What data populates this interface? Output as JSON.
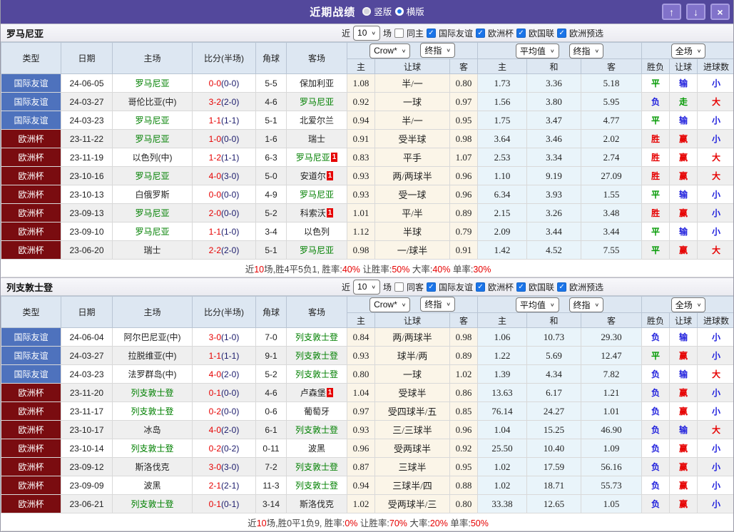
{
  "palette": {
    "titlebar_purple": "#53489c",
    "type_blue": "#4e72bd",
    "type_maroon": "#7a0c10",
    "win_red": "#e60000",
    "draw_green": "#009900",
    "loss_blue": "#2020dd",
    "team_green": "#008000",
    "handicap_bg": "#fbf5e8",
    "avg_bg": "#e9f4fa"
  },
  "titlebar": {
    "title": "近期战绩",
    "radios": [
      {
        "label": "竖版",
        "selected": false
      },
      {
        "label": "横版",
        "selected": true
      }
    ],
    "buttons": {
      "up": "↑",
      "down": "↓",
      "close": "×"
    }
  },
  "columns": {
    "left": [
      "类型",
      "日期",
      "主场",
      "比分(半场)",
      "角球",
      "客场"
    ],
    "odds_sub": [
      "主",
      "让球",
      "客"
    ],
    "avg_sub": [
      "主",
      "和",
      "客"
    ],
    "result_sub": [
      "胜负",
      "让球",
      "进球数"
    ],
    "dropdowns": {
      "provider": "Crow*",
      "provider_final": "终指",
      "avg": "平均值",
      "avg_final": "终指",
      "scope": "全场"
    }
  },
  "sections": [
    {
      "team": "罗马尼亚",
      "filter": {
        "near_label": "近",
        "matches_value": "10",
        "matches_label": "场",
        "same_label": "同主",
        "same_checked": false,
        "competitions": [
          {
            "label": "国际友谊",
            "checked": true
          },
          {
            "label": "欧洲杯",
            "checked": true
          },
          {
            "label": "欧国联",
            "checked": true
          },
          {
            "label": "欧洲预选",
            "checked": true
          }
        ]
      },
      "rows": [
        {
          "type": "国际友谊",
          "tc": "blue",
          "date": "24-06-05",
          "home": {
            "n": "罗马尼亚",
            "g": true,
            "b": ""
          },
          "ft": "0-0",
          "ht": "(0-0)",
          "cn": "5-5",
          "away": {
            "n": "保加利亚",
            "g": false,
            "b": ""
          },
          "odds": [
            "1.08",
            "半/一",
            "0.80"
          ],
          "avg": [
            "1.73",
            "3.36",
            "5.18"
          ],
          "res": [
            [
              "平",
              "g"
            ],
            [
              "输",
              "b"
            ],
            [
              "小",
              "b"
            ]
          ]
        },
        {
          "type": "国际友谊",
          "tc": "blue",
          "date": "24-03-27",
          "home": {
            "n": "哥伦比亚(中)",
            "g": false,
            "b": ""
          },
          "ft": "3-2",
          "ht": "(2-0)",
          "cn": "4-6",
          "away": {
            "n": "罗马尼亚",
            "g": true,
            "b": ""
          },
          "odds": [
            "0.92",
            "一球",
            "0.97"
          ],
          "avg": [
            "1.56",
            "3.80",
            "5.95"
          ],
          "res": [
            [
              "负",
              "b"
            ],
            [
              "走",
              "g"
            ],
            [
              "大",
              "r"
            ]
          ]
        },
        {
          "type": "国际友谊",
          "tc": "blue",
          "date": "24-03-23",
          "home": {
            "n": "罗马尼亚",
            "g": true,
            "b": ""
          },
          "ft": "1-1",
          "ht": "(1-1)",
          "cn": "5-1",
          "away": {
            "n": "北爱尔兰",
            "g": false,
            "b": ""
          },
          "odds": [
            "0.94",
            "半/一",
            "0.95"
          ],
          "avg": [
            "1.75",
            "3.47",
            "4.77"
          ],
          "res": [
            [
              "平",
              "g"
            ],
            [
              "输",
              "b"
            ],
            [
              "小",
              "b"
            ]
          ]
        },
        {
          "type": "欧洲杯",
          "tc": "maroon",
          "date": "23-11-22",
          "home": {
            "n": "罗马尼亚",
            "g": true,
            "b": ""
          },
          "ft": "1-0",
          "ht": "(0-0)",
          "cn": "1-6",
          "away": {
            "n": "瑞士",
            "g": false,
            "b": ""
          },
          "odds": [
            "0.91",
            "受半球",
            "0.98"
          ],
          "avg": [
            "3.64",
            "3.46",
            "2.02"
          ],
          "res": [
            [
              "胜",
              "r"
            ],
            [
              "赢",
              "r"
            ],
            [
              "小",
              "b"
            ]
          ]
        },
        {
          "type": "欧洲杯",
          "tc": "maroon",
          "date": "23-11-19",
          "home": {
            "n": "以色列(中)",
            "g": false,
            "b": ""
          },
          "ft": "1-2",
          "ht": "(1-1)",
          "cn": "6-3",
          "away": {
            "n": "罗马尼亚",
            "g": true,
            "b": "1"
          },
          "odds": [
            "0.83",
            "平手",
            "1.07"
          ],
          "avg": [
            "2.53",
            "3.34",
            "2.74"
          ],
          "res": [
            [
              "胜",
              "r"
            ],
            [
              "赢",
              "r"
            ],
            [
              "大",
              "r"
            ]
          ]
        },
        {
          "type": "欧洲杯",
          "tc": "maroon",
          "date": "23-10-16",
          "home": {
            "n": "罗马尼亚",
            "g": true,
            "b": ""
          },
          "ft": "4-0",
          "ht": "(3-0)",
          "cn": "5-0",
          "away": {
            "n": "安道尔",
            "g": false,
            "b": "1"
          },
          "odds": [
            "0.93",
            "两/两球半",
            "0.96"
          ],
          "avg": [
            "1.10",
            "9.19",
            "27.09"
          ],
          "res": [
            [
              "胜",
              "r"
            ],
            [
              "赢",
              "r"
            ],
            [
              "大",
              "r"
            ]
          ]
        },
        {
          "type": "欧洲杯",
          "tc": "maroon",
          "date": "23-10-13",
          "home": {
            "n": "白俄罗斯",
            "g": false,
            "b": ""
          },
          "ft": "0-0",
          "ht": "(0-0)",
          "cn": "4-9",
          "away": {
            "n": "罗马尼亚",
            "g": true,
            "b": ""
          },
          "odds": [
            "0.93",
            "受一球",
            "0.96"
          ],
          "avg": [
            "6.34",
            "3.93",
            "1.55"
          ],
          "res": [
            [
              "平",
              "g"
            ],
            [
              "输",
              "b"
            ],
            [
              "小",
              "b"
            ]
          ]
        },
        {
          "type": "欧洲杯",
          "tc": "maroon",
          "date": "23-09-13",
          "home": {
            "n": "罗马尼亚",
            "g": true,
            "b": ""
          },
          "ft": "2-0",
          "ht": "(0-0)",
          "cn": "5-2",
          "away": {
            "n": "科索沃",
            "g": false,
            "b": "1"
          },
          "odds": [
            "1.01",
            "平/半",
            "0.89"
          ],
          "avg": [
            "2.15",
            "3.26",
            "3.48"
          ],
          "res": [
            [
              "胜",
              "r"
            ],
            [
              "赢",
              "r"
            ],
            [
              "小",
              "b"
            ]
          ]
        },
        {
          "type": "欧洲杯",
          "tc": "maroon",
          "date": "23-09-10",
          "home": {
            "n": "罗马尼亚",
            "g": true,
            "b": ""
          },
          "ft": "1-1",
          "ht": "(1-0)",
          "cn": "3-4",
          "away": {
            "n": "以色列",
            "g": false,
            "b": ""
          },
          "odds": [
            "1.12",
            "半球",
            "0.79"
          ],
          "avg": [
            "2.09",
            "3.44",
            "3.44"
          ],
          "res": [
            [
              "平",
              "g"
            ],
            [
              "输",
              "b"
            ],
            [
              "小",
              "b"
            ]
          ]
        },
        {
          "type": "欧洲杯",
          "tc": "maroon",
          "date": "23-06-20",
          "home": {
            "n": "瑞士",
            "g": false,
            "b": ""
          },
          "ft": "2-2",
          "ht": "(2-0)",
          "cn": "5-1",
          "away": {
            "n": "罗马尼亚",
            "g": true,
            "b": ""
          },
          "odds": [
            "0.98",
            "一/球半",
            "0.91"
          ],
          "avg": [
            "1.42",
            "4.52",
            "7.55"
          ],
          "res": [
            [
              "平",
              "g"
            ],
            [
              "赢",
              "r"
            ],
            [
              "大",
              "r"
            ]
          ]
        }
      ],
      "summary": [
        {
          "t": "近",
          "red": false
        },
        {
          "t": "10",
          "red": true
        },
        {
          "t": "场,胜4平5负1, 胜率:",
          "red": false
        },
        {
          "t": "40%",
          "red": true
        },
        {
          "t": " 让胜率:",
          "red": false
        },
        {
          "t": "50%",
          "red": true
        },
        {
          "t": " 大率:",
          "red": false
        },
        {
          "t": "40%",
          "red": true
        },
        {
          "t": " 单率:",
          "red": false
        },
        {
          "t": "30%",
          "red": true
        }
      ]
    },
    {
      "team": "列支敦士登",
      "filter": {
        "near_label": "近",
        "matches_value": "10",
        "matches_label": "场",
        "same_label": "同客",
        "same_checked": false,
        "competitions": [
          {
            "label": "国际友谊",
            "checked": true
          },
          {
            "label": "欧洲杯",
            "checked": true
          },
          {
            "label": "欧国联",
            "checked": true
          },
          {
            "label": "欧洲预选",
            "checked": true
          }
        ]
      },
      "rows": [
        {
          "type": "国际友谊",
          "tc": "blue",
          "date": "24-06-04",
          "home": {
            "n": "阿尔巴尼亚(中)",
            "g": false,
            "b": ""
          },
          "ft": "3-0",
          "ht": "(1-0)",
          "cn": "7-0",
          "away": {
            "n": "列支敦士登",
            "g": true,
            "b": ""
          },
          "odds": [
            "0.84",
            "两/两球半",
            "0.98"
          ],
          "avg": [
            "1.06",
            "10.73",
            "29.30"
          ],
          "res": [
            [
              "负",
              "b"
            ],
            [
              "输",
              "b"
            ],
            [
              "小",
              "b"
            ]
          ]
        },
        {
          "type": "国际友谊",
          "tc": "blue",
          "date": "24-03-27",
          "home": {
            "n": "拉脱维亚(中)",
            "g": false,
            "b": ""
          },
          "ft": "1-1",
          "ht": "(1-1)",
          "cn": "9-1",
          "away": {
            "n": "列支敦士登",
            "g": true,
            "b": ""
          },
          "odds": [
            "0.93",
            "球半/两",
            "0.89"
          ],
          "avg": [
            "1.22",
            "5.69",
            "12.47"
          ],
          "res": [
            [
              "平",
              "g"
            ],
            [
              "赢",
              "r"
            ],
            [
              "小",
              "b"
            ]
          ]
        },
        {
          "type": "国际友谊",
          "tc": "blue",
          "date": "24-03-23",
          "home": {
            "n": "法罗群岛(中)",
            "g": false,
            "b": ""
          },
          "ft": "4-0",
          "ht": "(2-0)",
          "cn": "5-2",
          "away": {
            "n": "列支敦士登",
            "g": true,
            "b": ""
          },
          "odds": [
            "0.80",
            "一球",
            "1.02"
          ],
          "avg": [
            "1.39",
            "4.34",
            "7.82"
          ],
          "res": [
            [
              "负",
              "b"
            ],
            [
              "输",
              "b"
            ],
            [
              "大",
              "r"
            ]
          ]
        },
        {
          "type": "欧洲杯",
          "tc": "maroon",
          "date": "23-11-20",
          "home": {
            "n": "列支敦士登",
            "g": true,
            "b": ""
          },
          "ft": "0-1",
          "ht": "(0-0)",
          "cn": "4-6",
          "away": {
            "n": "卢森堡",
            "g": false,
            "b": "1"
          },
          "odds": [
            "1.04",
            "受球半",
            "0.86"
          ],
          "avg": [
            "13.63",
            "6.17",
            "1.21"
          ],
          "res": [
            [
              "负",
              "b"
            ],
            [
              "赢",
              "r"
            ],
            [
              "小",
              "b"
            ]
          ]
        },
        {
          "type": "欧洲杯",
          "tc": "maroon",
          "date": "23-11-17",
          "home": {
            "n": "列支敦士登",
            "g": true,
            "b": ""
          },
          "ft": "0-2",
          "ht": "(0-0)",
          "cn": "0-6",
          "away": {
            "n": "葡萄牙",
            "g": false,
            "b": ""
          },
          "odds": [
            "0.97",
            "受四球半/五",
            "0.85"
          ],
          "avg": [
            "76.14",
            "24.27",
            "1.01"
          ],
          "res": [
            [
              "负",
              "b"
            ],
            [
              "赢",
              "r"
            ],
            [
              "小",
              "b"
            ]
          ]
        },
        {
          "type": "欧洲杯",
          "tc": "maroon",
          "date": "23-10-17",
          "home": {
            "n": "冰岛",
            "g": false,
            "b": ""
          },
          "ft": "4-0",
          "ht": "(2-0)",
          "cn": "6-1",
          "away": {
            "n": "列支敦士登",
            "g": true,
            "b": ""
          },
          "odds": [
            "0.93",
            "三/三球半",
            "0.96"
          ],
          "avg": [
            "1.04",
            "15.25",
            "46.90"
          ],
          "res": [
            [
              "负",
              "b"
            ],
            [
              "输",
              "b"
            ],
            [
              "大",
              "r"
            ]
          ]
        },
        {
          "type": "欧洲杯",
          "tc": "maroon",
          "date": "23-10-14",
          "home": {
            "n": "列支敦士登",
            "g": true,
            "b": ""
          },
          "ft": "0-2",
          "ht": "(0-2)",
          "cn": "0-11",
          "away": {
            "n": "波黑",
            "g": false,
            "b": ""
          },
          "odds": [
            "0.96",
            "受两球半",
            "0.92"
          ],
          "avg": [
            "25.50",
            "10.40",
            "1.09"
          ],
          "res": [
            [
              "负",
              "b"
            ],
            [
              "赢",
              "r"
            ],
            [
              "小",
              "b"
            ]
          ]
        },
        {
          "type": "欧洲杯",
          "tc": "maroon",
          "date": "23-09-12",
          "home": {
            "n": "斯洛伐克",
            "g": false,
            "b": ""
          },
          "ft": "3-0",
          "ht": "(3-0)",
          "cn": "7-2",
          "away": {
            "n": "列支敦士登",
            "g": true,
            "b": ""
          },
          "odds": [
            "0.87",
            "三球半",
            "0.95"
          ],
          "avg": [
            "1.02",
            "17.59",
            "56.16"
          ],
          "res": [
            [
              "负",
              "b"
            ],
            [
              "赢",
              "r"
            ],
            [
              "小",
              "b"
            ]
          ]
        },
        {
          "type": "欧洲杯",
          "tc": "maroon",
          "date": "23-09-09",
          "home": {
            "n": "波黑",
            "g": false,
            "b": ""
          },
          "ft": "2-1",
          "ht": "(2-1)",
          "cn": "11-3",
          "away": {
            "n": "列支敦士登",
            "g": true,
            "b": ""
          },
          "odds": [
            "0.94",
            "三球半/四",
            "0.88"
          ],
          "avg": [
            "1.02",
            "18.71",
            "55.73"
          ],
          "res": [
            [
              "负",
              "b"
            ],
            [
              "赢",
              "r"
            ],
            [
              "小",
              "b"
            ]
          ]
        },
        {
          "type": "欧洲杯",
          "tc": "maroon",
          "date": "23-06-21",
          "home": {
            "n": "列支敦士登",
            "g": true,
            "b": ""
          },
          "ft": "0-1",
          "ht": "(0-1)",
          "cn": "3-14",
          "away": {
            "n": "斯洛伐克",
            "g": false,
            "b": ""
          },
          "odds": [
            "1.02",
            "受两球半/三",
            "0.80"
          ],
          "avg": [
            "33.38",
            "12.65",
            "1.05"
          ],
          "res": [
            [
              "负",
              "b"
            ],
            [
              "赢",
              "r"
            ],
            [
              "小",
              "b"
            ]
          ]
        }
      ],
      "summary": [
        {
          "t": "近",
          "red": false
        },
        {
          "t": "10",
          "red": true
        },
        {
          "t": "场,胜0平1负9, 胜率:",
          "red": false
        },
        {
          "t": "0%",
          "red": true
        },
        {
          "t": " 让胜率:",
          "red": false
        },
        {
          "t": "70%",
          "red": true
        },
        {
          "t": " 大率:",
          "red": false
        },
        {
          "t": "20%",
          "red": true
        },
        {
          "t": " 单率:",
          "red": false
        },
        {
          "t": "50%",
          "red": true
        }
      ]
    }
  ]
}
